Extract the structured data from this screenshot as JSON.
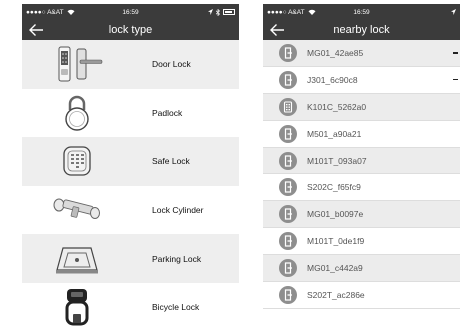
{
  "left_screen": {
    "status": {
      "carrier": "●●●●○ A&AT",
      "time": "16:59"
    },
    "title": "lock type",
    "lock_types": [
      {
        "label": "Door Lock",
        "icon": "door-lock-icon"
      },
      {
        "label": "Padlock",
        "icon": "padlock-icon"
      },
      {
        "label": "Safe Lock",
        "icon": "safe-lock-icon"
      },
      {
        "label": "Lock Cylinder",
        "icon": "lock-cylinder-icon"
      },
      {
        "label": "Parking Lock",
        "icon": "parking-lock-icon"
      },
      {
        "label": "Bicycle Lock",
        "icon": "bicycle-lock-icon"
      }
    ]
  },
  "right_screen": {
    "status": {
      "carrier": "●●●●○ A&AT",
      "time": "16:59"
    },
    "title": "nearby lock",
    "devices": [
      {
        "name": "MG01_42ae85",
        "icon": "door-lock-icon"
      },
      {
        "name": "J301_6c90c8",
        "icon": "door-lock-icon"
      },
      {
        "name": "K101C_5262a0",
        "icon": "keypad-lock-icon"
      },
      {
        "name": "M501_a90a21",
        "icon": "door-lock-icon"
      },
      {
        "name": "M101T_093a07",
        "icon": "door-lock-icon"
      },
      {
        "name": "S202C_f65fc9",
        "icon": "door-lock-icon"
      },
      {
        "name": "MG01_b0097e",
        "icon": "door-lock-icon"
      },
      {
        "name": "M101T_0de1f9",
        "icon": "door-lock-icon"
      },
      {
        "name": "MG01_c442a9",
        "icon": "door-lock-icon"
      },
      {
        "name": "S202T_ac286e",
        "icon": "door-lock-icon"
      }
    ]
  },
  "colors": {
    "header_bg": "#3b3b3b",
    "row_alt_bg": "#eeeeee",
    "device_icon_bg": "#8e8e8e"
  }
}
